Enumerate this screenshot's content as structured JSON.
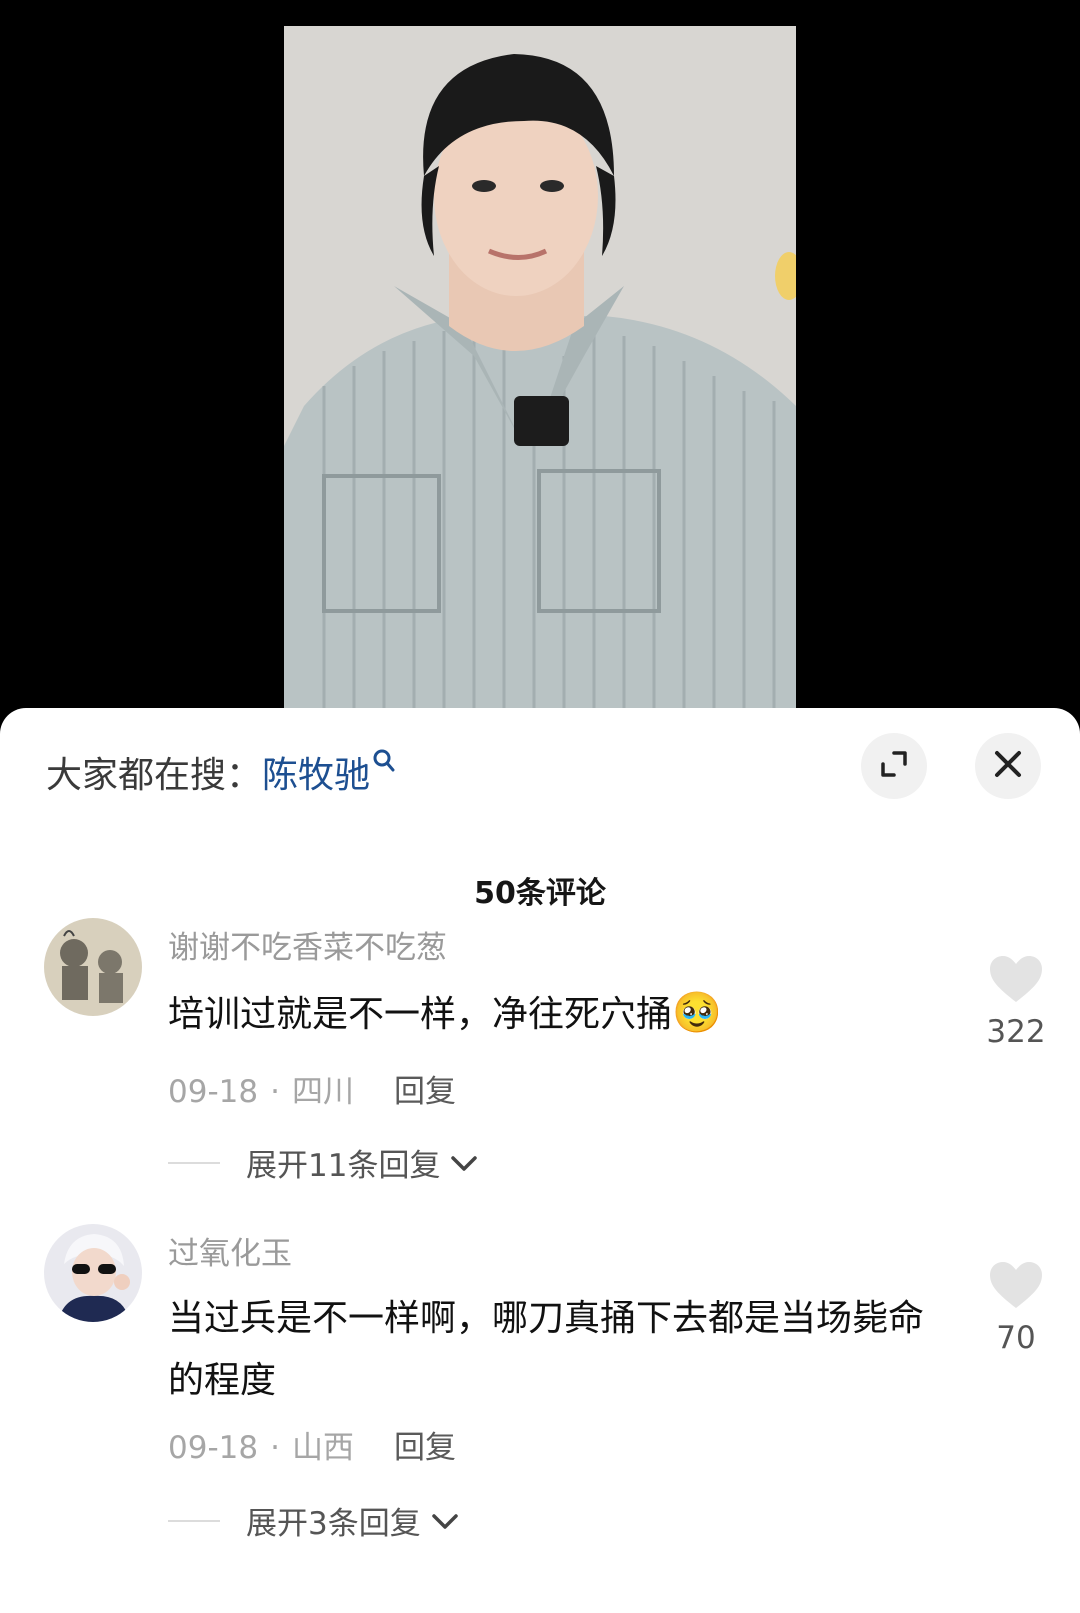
{
  "trending": {
    "prefix": "大家都在搜：",
    "term": "陈牧驰"
  },
  "sheet": {
    "title": "50条评论"
  },
  "comments": [
    {
      "username": "谢谢不吃香菜不吃葱",
      "text": "培训过就是不一样，净往死穴捅",
      "emoji": "🥹",
      "date": "09-18",
      "location": "四川",
      "reply_label": "回复",
      "likes": "322",
      "expand_label": "展开11条回复"
    },
    {
      "username": "过氧化玉",
      "text": "当过兵是不一样啊，哪刀真捅下去都是当场毙命的程度",
      "date": "09-18",
      "location": "山西",
      "reply_label": "回复",
      "likes": "70",
      "expand_label": "展开3条回复"
    }
  ],
  "colors": {
    "sheet_bg": "#ffffff",
    "search_term": "#1d4f91",
    "icon_bg": "#f1f1f1",
    "like_icon": "#e3e3e3"
  },
  "icons": [
    "search-icon",
    "expand-icon",
    "close-icon",
    "heart-icon",
    "chevron-down-icon"
  ]
}
